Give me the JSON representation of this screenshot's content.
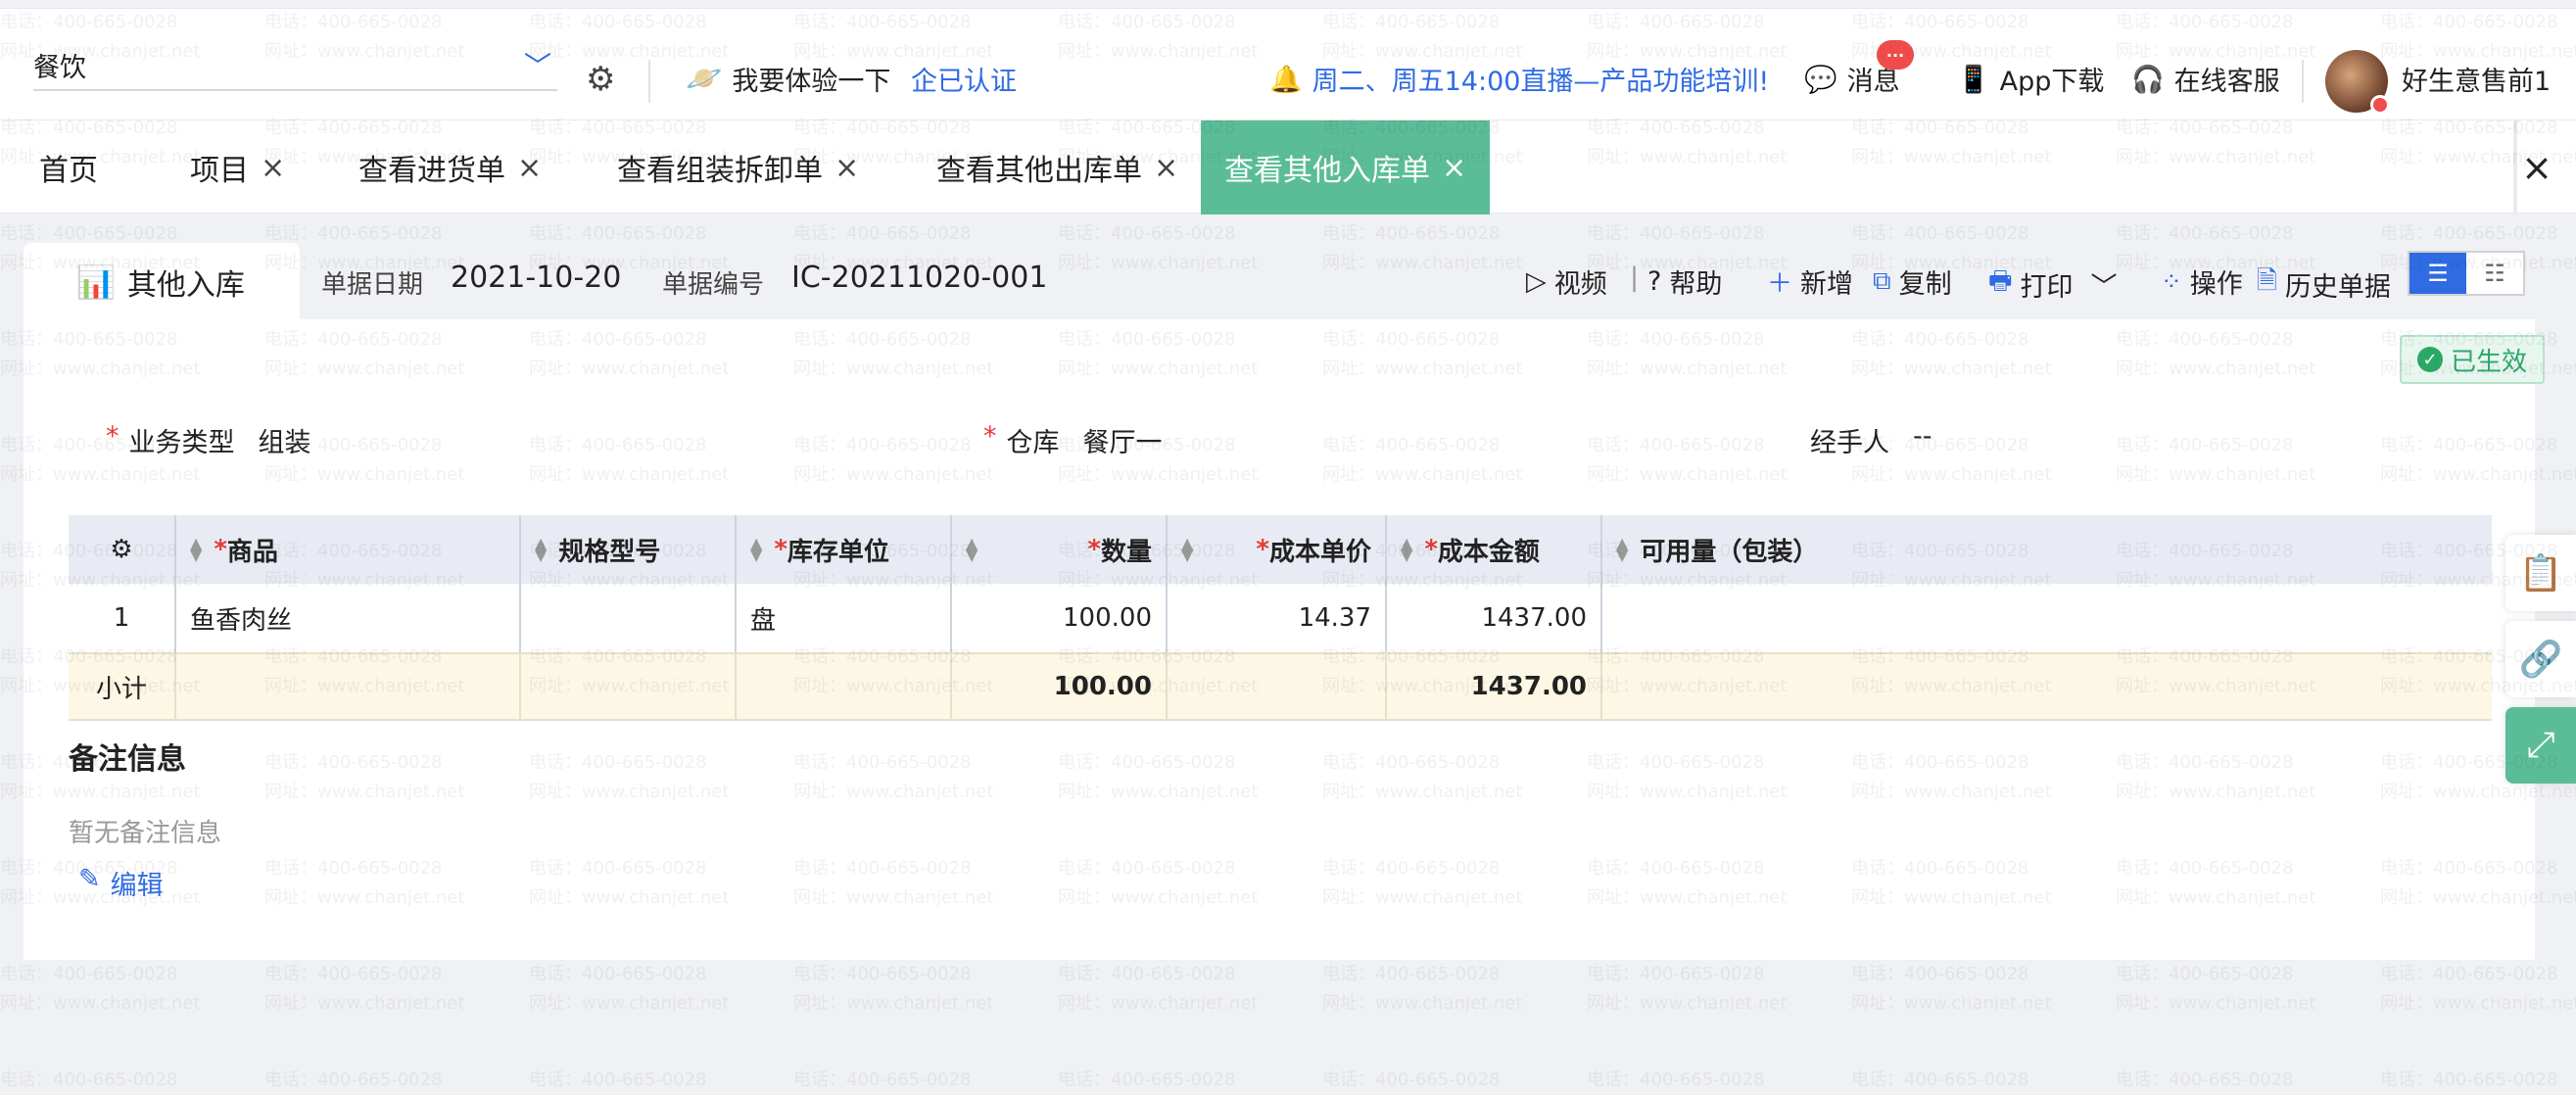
{
  "header": {
    "company": "餐饮",
    "experience": "我要体验一下",
    "verified": "企已认证",
    "notice": "周二、周五14:00直播—产品功能培训!",
    "messages": "消息",
    "message_badge": "···",
    "app_download": "App下载",
    "support": "在线客服",
    "user": "好生意售前1"
  },
  "tabs": [
    {
      "label": "首页",
      "closable": false
    },
    {
      "label": "项目",
      "closable": true
    },
    {
      "label": "查看进货单",
      "closable": true
    },
    {
      "label": "查看组装拆卸单",
      "closable": true
    },
    {
      "label": "查看其他出库单",
      "closable": true
    },
    {
      "label": "查看其他入库单",
      "closable": true,
      "active": true
    }
  ],
  "tab_close_symbol": "×",
  "document": {
    "tab_title": "其他入库",
    "date_label": "单据日期",
    "date": "2021-10-20",
    "number_label": "单据编号",
    "number": "IC-20211020-001",
    "status": "已生效"
  },
  "actions": {
    "video": "视频",
    "help": "帮助",
    "add": "新增",
    "copy": "复制",
    "print": "打印",
    "operate": "操作",
    "history": "历史单据"
  },
  "form": {
    "business_type_label": "业务类型",
    "business_type": "组装",
    "warehouse_label": "仓库",
    "warehouse": "餐厅一",
    "handler_label": "经手人",
    "handler": "--"
  },
  "table": {
    "columns": [
      "商品",
      "规格型号",
      "库存单位",
      "数量",
      "成本单价",
      "成本金额",
      "可用量（包装）"
    ],
    "rows": [
      {
        "index": "1",
        "product": "鱼香肉丝",
        "spec": "",
        "unit": "盘",
        "qty": "100.00",
        "unit_cost": "14.37",
        "amount": "1437.00",
        "available": ""
      }
    ],
    "subtotal": {
      "label": "小计",
      "qty": "100.00",
      "amount": "1437.00"
    }
  },
  "notes": {
    "title": "备注信息",
    "empty": "暂无备注信息",
    "edit": "编辑"
  }
}
